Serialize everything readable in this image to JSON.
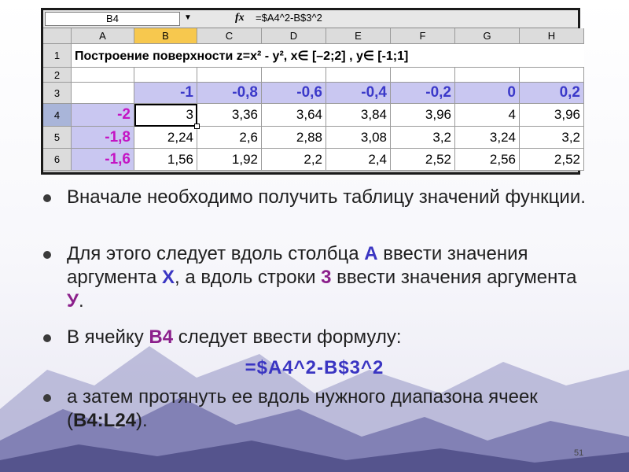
{
  "spreadsheet": {
    "namebox": "B4",
    "namebox_arrow": "▼",
    "fx_label": "fx",
    "formula": "=$A4^2-B$3^2",
    "columns": [
      "A",
      "B",
      "C",
      "D",
      "E",
      "F",
      "G",
      "H"
    ],
    "selected_column": "B",
    "selected_row": "4",
    "rows": [
      {
        "num": "1",
        "title": "Построение поверхности z=x² - y², x∈ [–2;2] ,  y∈ [-1;1]"
      },
      {
        "num": "2",
        "cells": [
          "",
          "",
          "",
          "",
          "",
          "",
          "",
          ""
        ]
      },
      {
        "num": "3",
        "cells": [
          "",
          "-1",
          "-0,8",
          "-0,6",
          "-0,4",
          "-0,2",
          "0",
          "0,2"
        ]
      },
      {
        "num": "4",
        "cells": [
          "-2",
          "3",
          "3,36",
          "3,64",
          "3,84",
          "3,96",
          "4",
          "3,96"
        ]
      },
      {
        "num": "5",
        "cells": [
          "-1,8",
          "2,24",
          "2,6",
          "2,88",
          "3,08",
          "3,2",
          "3,24",
          "3,2"
        ]
      },
      {
        "num": "6",
        "cells": [
          "-1,6",
          "1,56",
          "1,92",
          "2,2",
          "2,4",
          "2,52",
          "2,56",
          "2,52"
        ]
      }
    ]
  },
  "bullets": {
    "b1": "Вначале необходимо получить таблицу значений функции.",
    "b2_pre": "Для этого следует вдоль столбца ",
    "b2_a": "А",
    "b2_mid1": " ввести значения аргумента ",
    "b2_x": "Х",
    "b2_mid2": ", а вдоль строки ",
    "b2_3": "3",
    "b2_mid3": " ввести значения аргумента ",
    "b2_y": "У",
    "b2_end": ".",
    "b3_pre": "В ячейку ",
    "b3_cell": "В4",
    "b3_post": " следует ввести формулу:",
    "formula": "=$A4^2-B$3^2",
    "b4_pre": "а затем протянуть ее вдоль нужного диапазона ячеек (",
    "b4_range": "В4:L24",
    "b4_post": ")."
  },
  "slide_number": "51",
  "colors": {
    "highlight_blue": "#3a35c2",
    "highlight_purple": "#8b1f8b",
    "header_fill": "#c9c7f1",
    "selected_col_header": "#f7c84e"
  }
}
